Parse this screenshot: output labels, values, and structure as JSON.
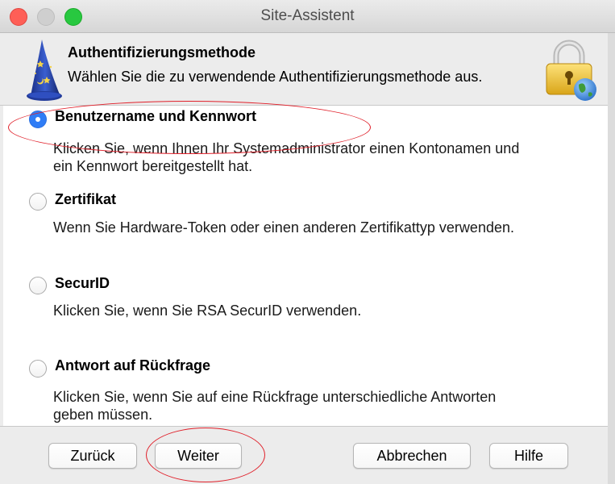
{
  "window": {
    "title": "Site-Assistent"
  },
  "header": {
    "title": "Authentifizierungsmethode",
    "subtitle": "Wählen Sie die zu verwendende Authentifizierungsmethode aus."
  },
  "options": [
    {
      "label": "Benutzername und Kennwort",
      "selected": true,
      "desc_lines": [
        "Klicken Sie, wenn Ihnen Ihr Systemadministrator einen Kontonamen und",
        "ein Kennwort bereitgestellt hat."
      ]
    },
    {
      "label": "Zertifikat",
      "selected": false,
      "desc_lines": [
        "Wenn Sie Hardware-Token oder einen anderen Zertifikattyp verwenden."
      ]
    },
    {
      "label": "SecurID",
      "selected": false,
      "desc_lines": [
        "Klicken Sie, wenn Sie RSA SecurID verwenden."
      ]
    },
    {
      "label": "Antwort auf Rückfrage",
      "selected": false,
      "desc_lines": [
        "Klicken Sie, wenn Sie auf eine Rückfrage unterschiedliche Antworten",
        "geben müssen."
      ]
    }
  ],
  "buttons": {
    "back": "Zurück",
    "next": "Weiter",
    "cancel": "Abbrechen",
    "help": "Hilfe"
  },
  "icons": {
    "header_left": "wizard-hat-icon",
    "header_right": "lock-globe-icon"
  },
  "colors": {
    "annotation": "#e0202a",
    "radio_selected": "#2f7df6"
  }
}
